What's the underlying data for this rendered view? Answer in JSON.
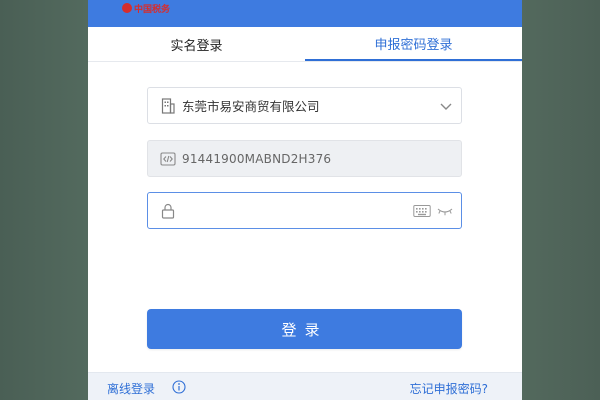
{
  "window": {
    "logo_text": "中国税务"
  },
  "tabs": [
    {
      "label": "实名登录",
      "active": false
    },
    {
      "label": "申报密码登录",
      "active": true
    }
  ],
  "form": {
    "company": {
      "icon": "building-icon",
      "value": "东莞市易安商贸有限公司"
    },
    "tax_code": {
      "icon": "code-icon",
      "value": "91441900MABND2H376"
    },
    "password": {
      "icon": "lock-icon",
      "value": "",
      "placeholder": ""
    }
  },
  "login_button": {
    "label": "登录"
  },
  "footer": {
    "offline_label": "离线登录",
    "forgot_label": "忘记申报密码?"
  },
  "colors": {
    "brand_blue": "#3e7be0",
    "link_blue": "#2f6fd6",
    "logo_red": "#d62d2d",
    "outer_bg": "#4e6358"
  }
}
